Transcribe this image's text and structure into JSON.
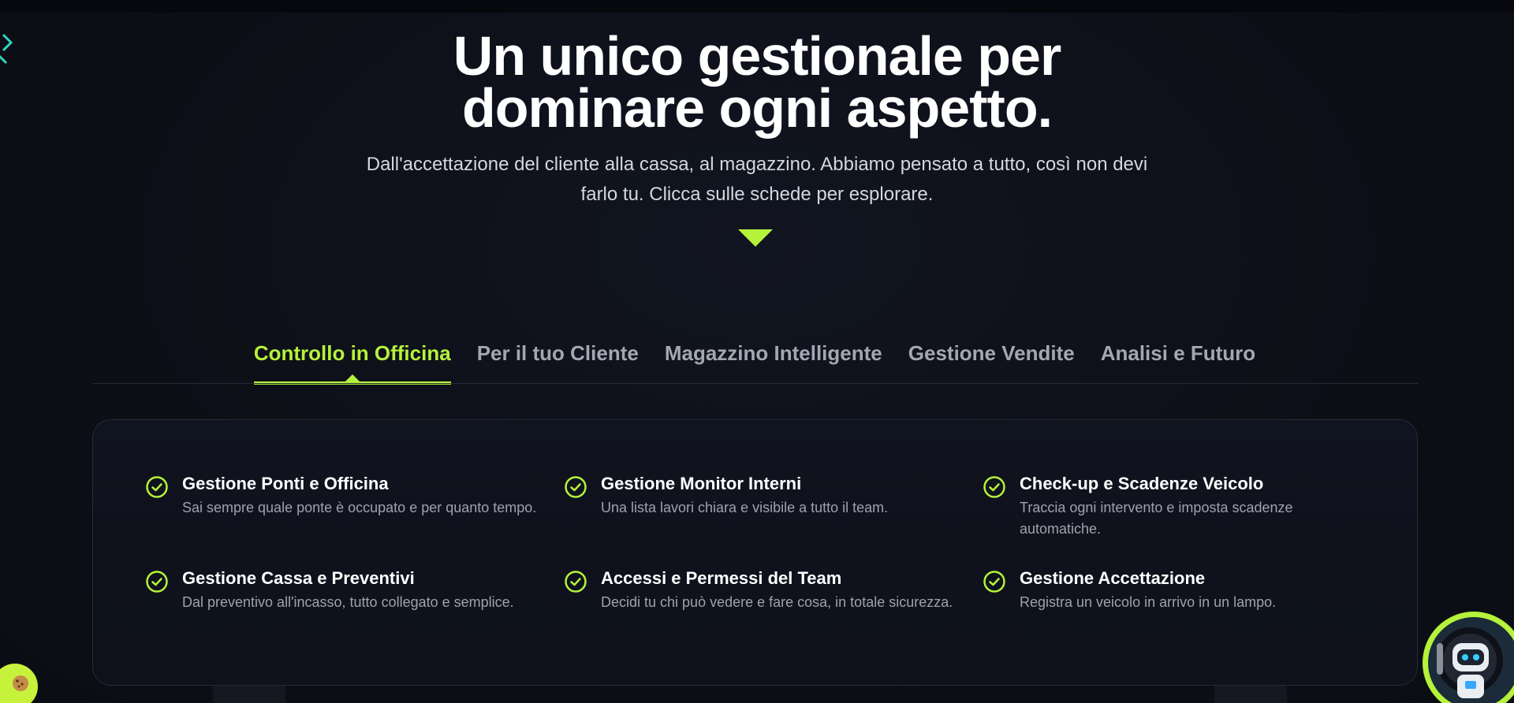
{
  "hero": {
    "title_line1": "Un unico gestionale per",
    "title_line2": "dominare ogni aspetto.",
    "subtitle": "Dall'accettazione del cliente alla cassa, al magazzino. Abbiamo pensato a tutto, così non devi farlo tu. Clicca sulle schede per esplorare."
  },
  "tabs": [
    {
      "label": "Controllo in Officina",
      "active": true
    },
    {
      "label": "Per il tuo Cliente",
      "active": false
    },
    {
      "label": "Magazzino Intelligente",
      "active": false
    },
    {
      "label": "Gestione Vendite",
      "active": false
    },
    {
      "label": "Analisi e Futuro",
      "active": false
    }
  ],
  "features": [
    {
      "title": "Gestione Ponti e Officina",
      "desc": "Sai sempre quale ponte è occupato e per quanto tempo."
    },
    {
      "title": "Gestione Monitor Interni",
      "desc": "Una lista lavori chiara e visibile a tutto il team."
    },
    {
      "title": "Check-up e Scadenze Veicolo",
      "desc": "Traccia ogni intervento e imposta scadenze automatiche."
    },
    {
      "title": "Gestione Cassa e Preventivi",
      "desc": "Dal preventivo all'incasso, tutto collegato e semplice."
    },
    {
      "title": "Accessi e Permessi del Team",
      "desc": "Decidi tu chi può vedere e fare cosa, in totale sicurezza."
    },
    {
      "title": "Gestione Accettazione",
      "desc": "Registra un veicolo in arrivo in un lampo."
    }
  ],
  "icons": {
    "feature": "check-circle-icon",
    "scroll": "triangle-down-icon",
    "corner": "chevron-right-icon",
    "cookie": "cookie-icon",
    "assistant": "robot-avatar-icon"
  },
  "colors": {
    "accent": "#b5f23a",
    "background": "#0d0f17",
    "muted_text": "#9ea2ad",
    "tab_inactive": "#a3a7b2"
  }
}
